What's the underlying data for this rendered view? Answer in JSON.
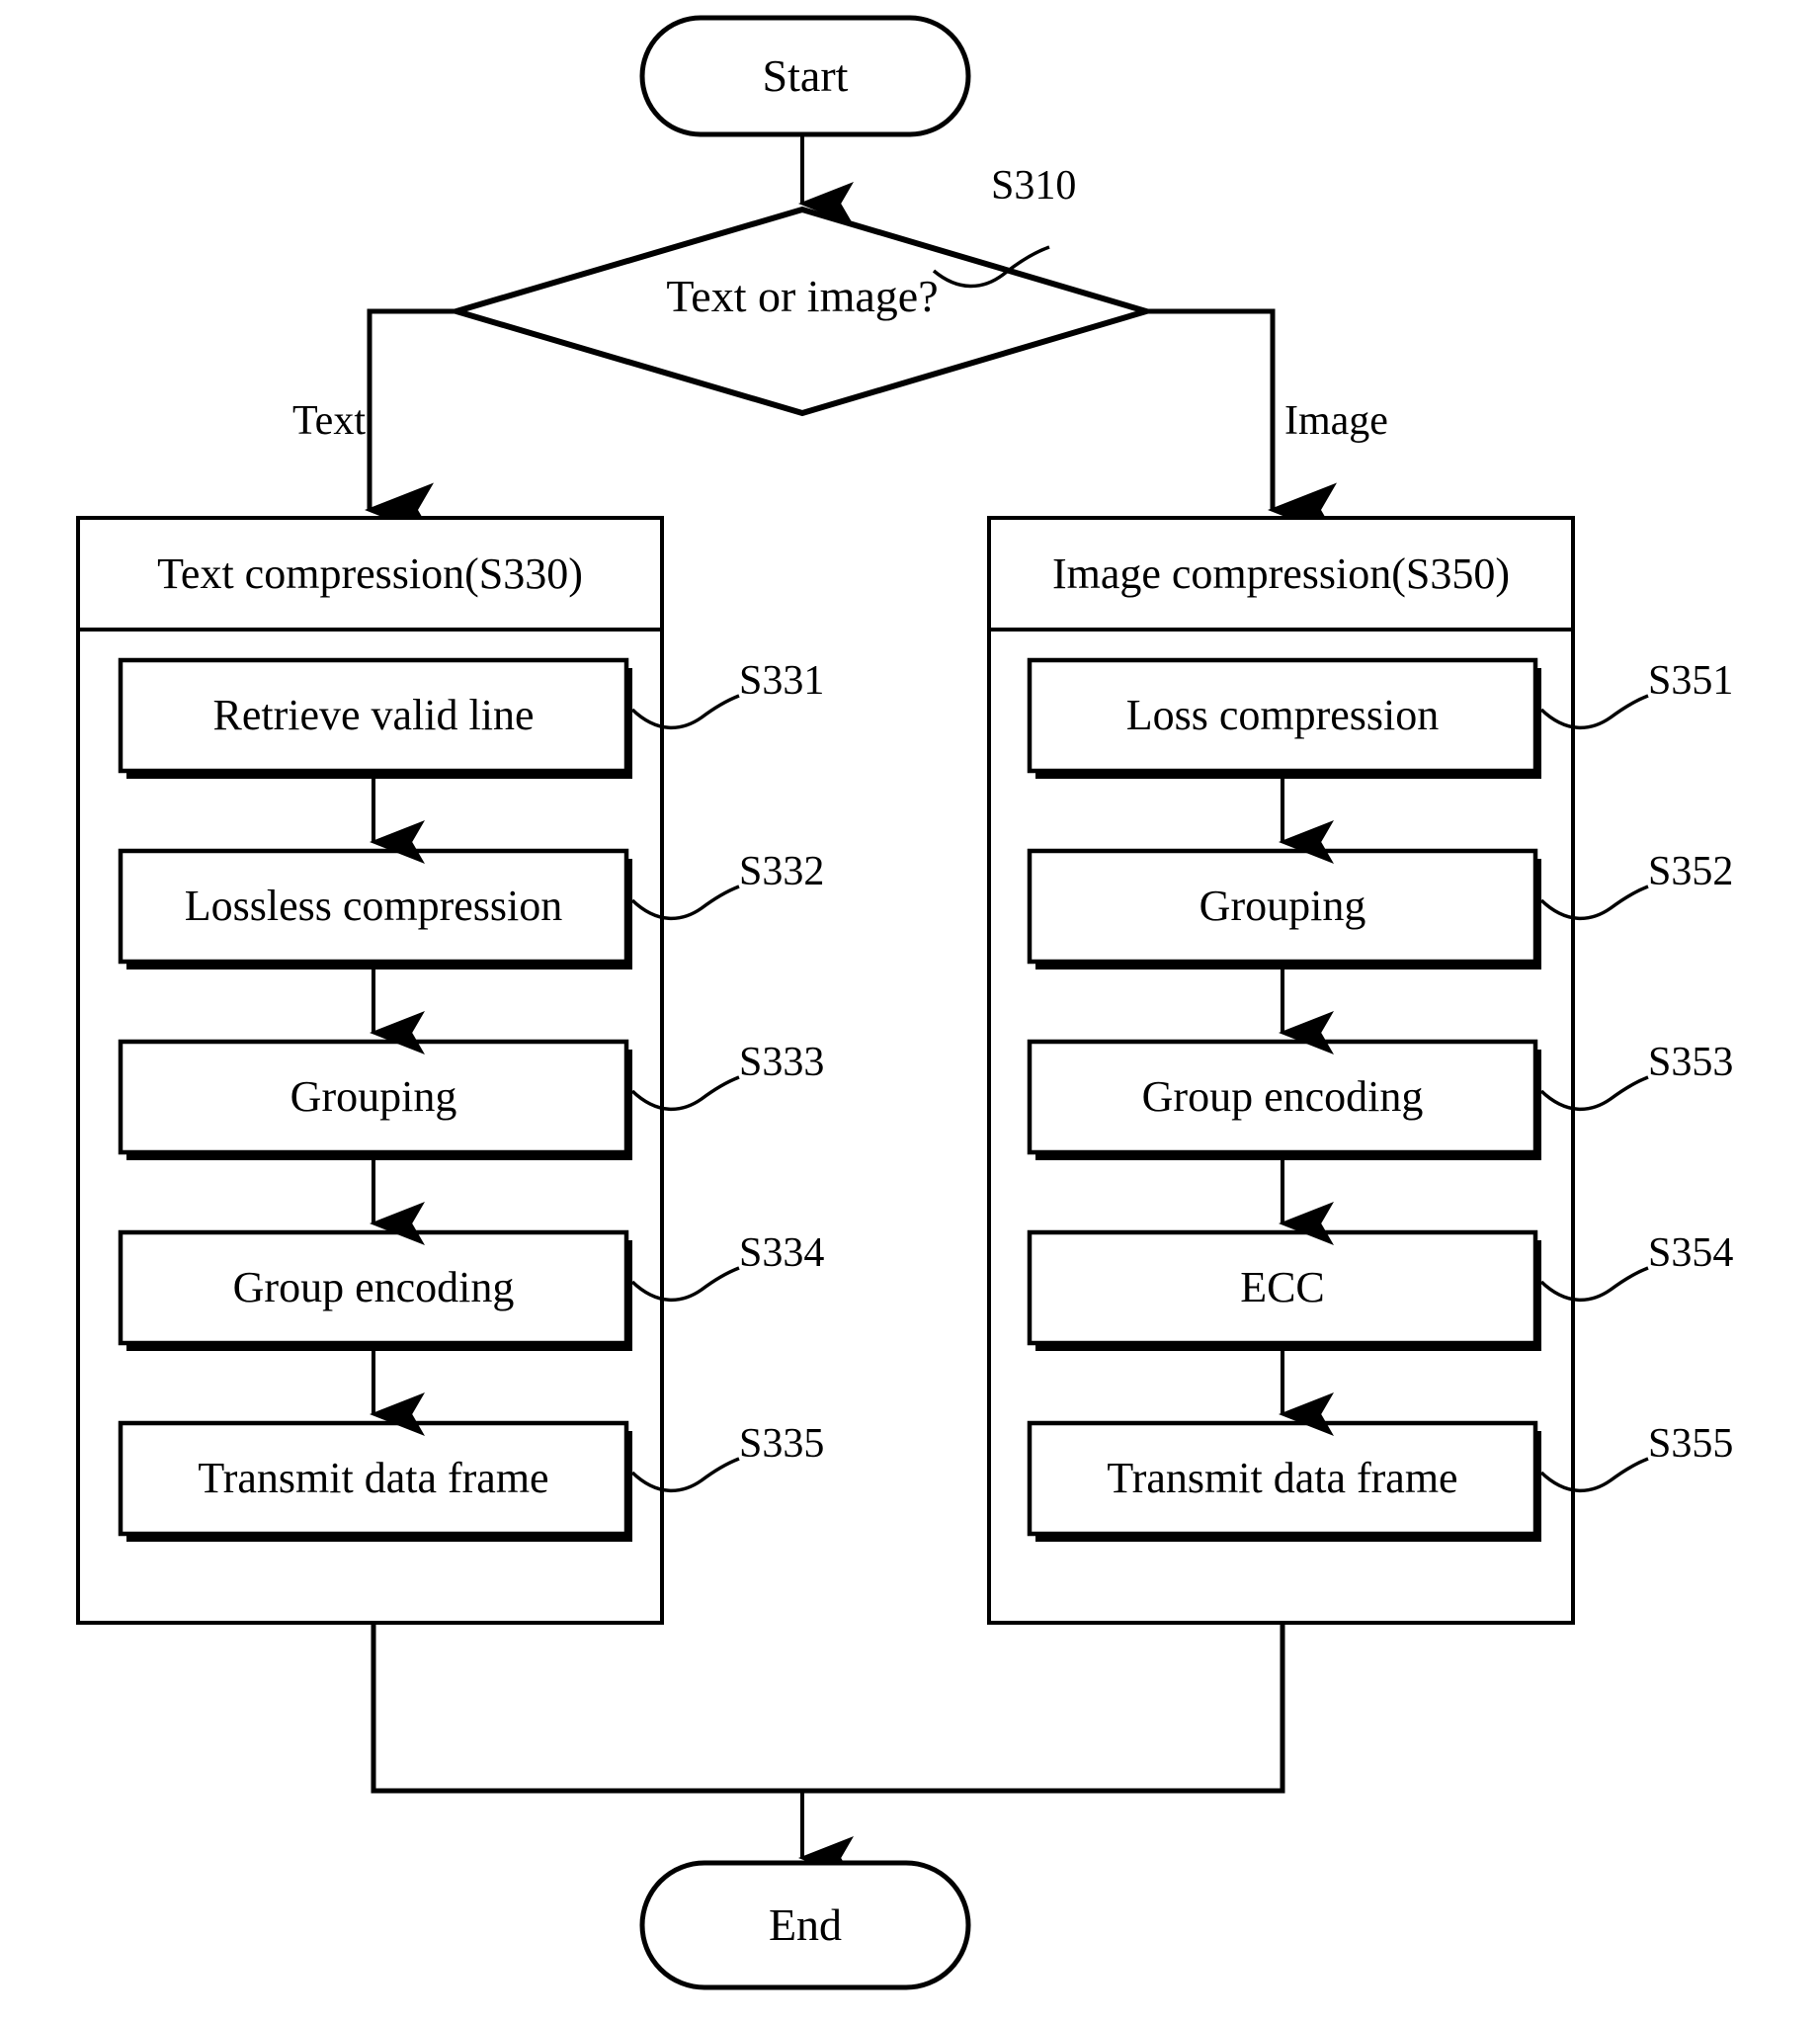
{
  "diagram": {
    "type": "flowchart",
    "start": {
      "label": "Start"
    },
    "end": {
      "label": "End"
    },
    "decision": {
      "label": "Text or image?",
      "ref": "S310",
      "branches": [
        {
          "label": "Text",
          "side": "left"
        },
        {
          "label": "Image",
          "side": "right"
        }
      ]
    },
    "columns": [
      {
        "id": "text-column",
        "header": "Text compression(S330)",
        "steps": [
          {
            "label": "Retrieve valid line",
            "ref": "S331"
          },
          {
            "label": "Lossless compression",
            "ref": "S332"
          },
          {
            "label": "Grouping",
            "ref": "S333"
          },
          {
            "label": "Group encoding",
            "ref": "S334"
          },
          {
            "label": "Transmit data frame",
            "ref": "S335"
          }
        ]
      },
      {
        "id": "image-column",
        "header": "Image compression(S350)",
        "steps": [
          {
            "label": "Loss compression",
            "ref": "S351"
          },
          {
            "label": "Grouping",
            "ref": "S352"
          },
          {
            "label": "Group encoding",
            "ref": "S353"
          },
          {
            "label": "ECC",
            "ref": "S354"
          },
          {
            "label": "Transmit data frame",
            "ref": "S355"
          }
        ]
      }
    ],
    "colors": {
      "stroke": "#000000",
      "fill": "#ffffff",
      "text": "#000000"
    }
  }
}
